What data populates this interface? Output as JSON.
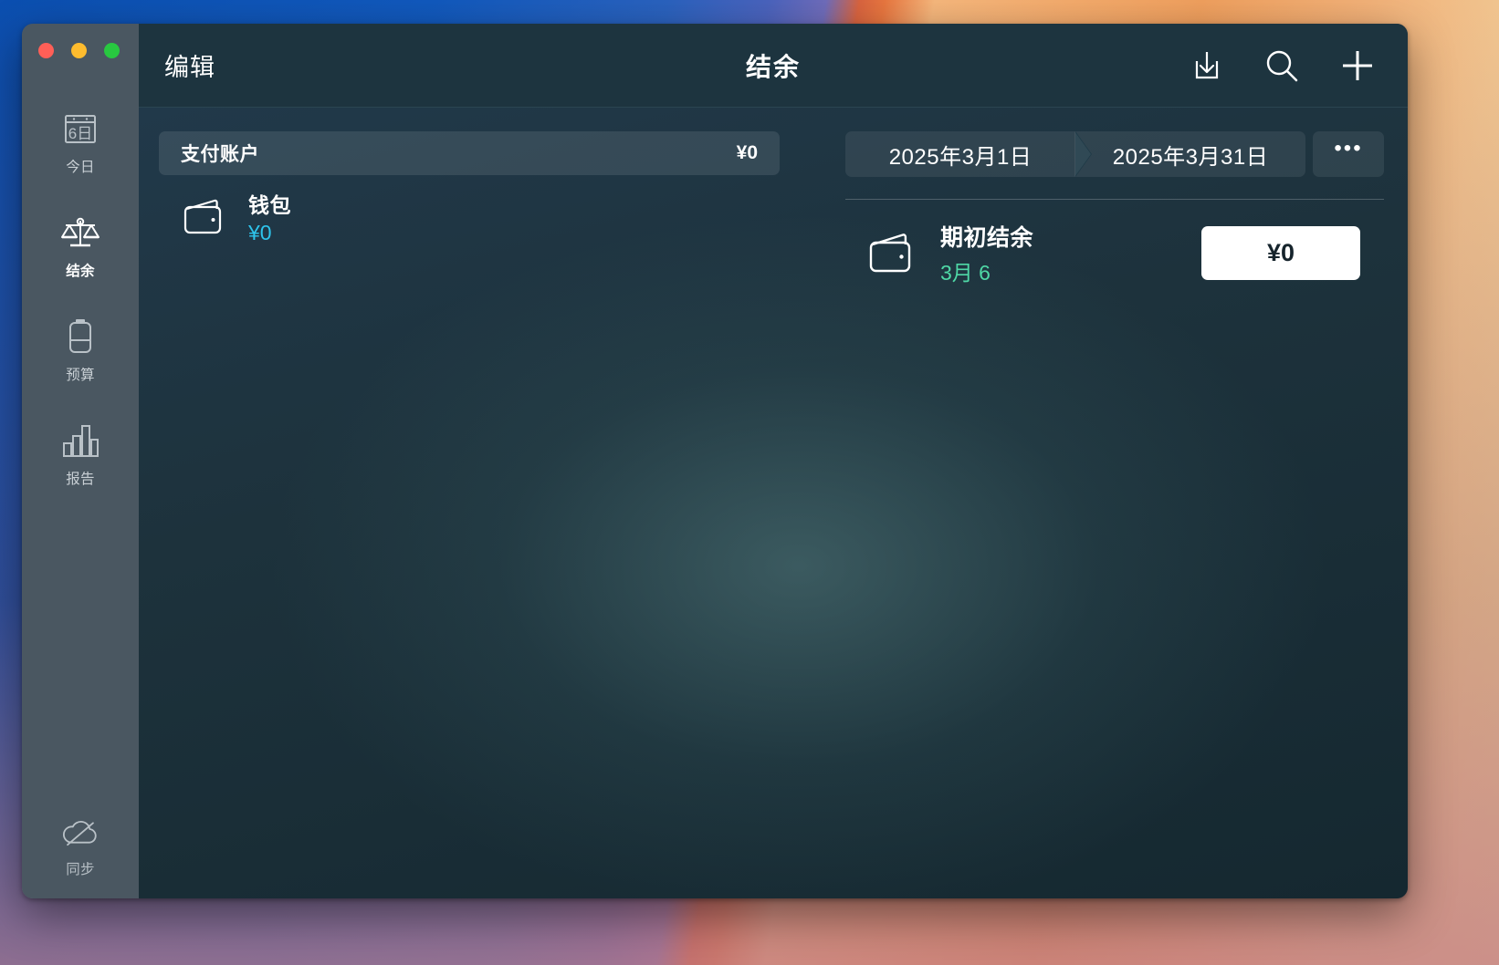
{
  "window": {
    "title": "结余",
    "edit_label": "编辑",
    "traffic_lights": [
      "close",
      "minimize",
      "zoom"
    ]
  },
  "toolbar": {
    "import_icon": "download-box-icon",
    "search_icon": "search-icon",
    "add_icon": "plus-icon"
  },
  "sidebar": {
    "items": [
      {
        "label": "今日",
        "icon": "calendar-6-icon",
        "active": false
      },
      {
        "label": "结余",
        "icon": "balance-scale-icon",
        "active": true
      },
      {
        "label": "预算",
        "icon": "battery-budget-icon",
        "active": false
      },
      {
        "label": "报告",
        "icon": "bar-chart-icon",
        "active": false
      }
    ],
    "footer": {
      "label": "同步",
      "icon": "cloud-slash-icon"
    }
  },
  "accounts": {
    "group": {
      "name": "支付账户",
      "amount": "¥0"
    },
    "rows": [
      {
        "name": "钱包",
        "amount": "¥0",
        "icon": "wallet-icon"
      }
    ]
  },
  "details": {
    "date_range": {
      "start": "2025年3月1日",
      "end": "2025年3月31日",
      "options_label": "•••"
    },
    "opening_balance": {
      "title": "期初结余",
      "date": "3月 6",
      "value": "¥0",
      "icon": "wallet-icon"
    }
  },
  "colors": {
    "accent_cyan": "#2ec4ec",
    "accent_green": "#4fd8a6",
    "sidebar_bg": "#4a5761",
    "titlebar_bg": "#1d343f",
    "content_bg": "#1d323c"
  }
}
